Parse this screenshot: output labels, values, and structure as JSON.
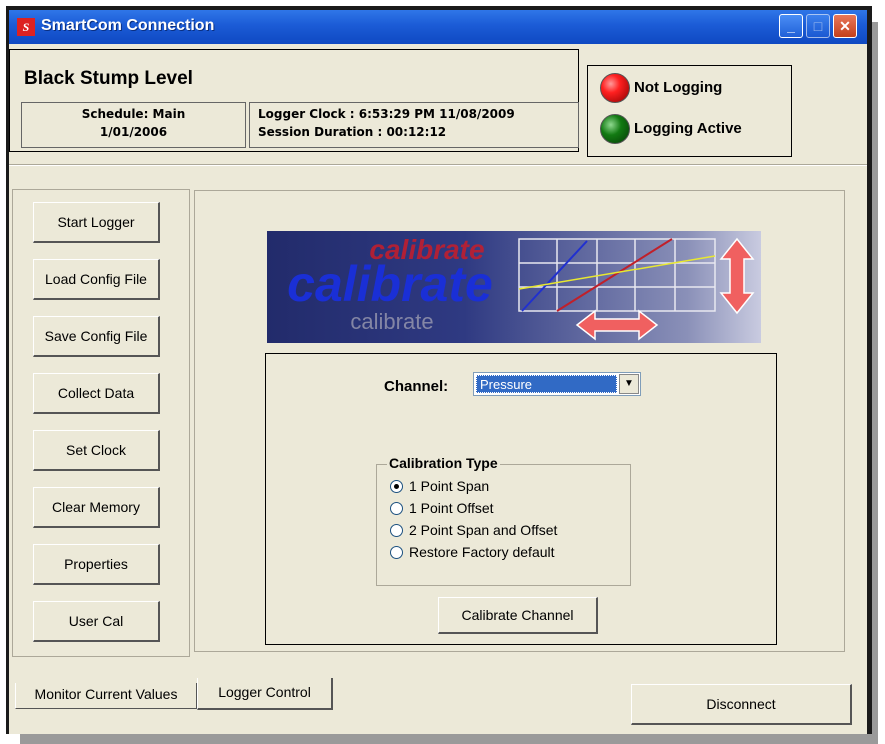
{
  "window": {
    "title": "SmartCom Connection",
    "icon_text": "S",
    "minimize_glyph": "_",
    "maximize_glyph": "□",
    "close_glyph": "✕"
  },
  "header": {
    "title": "Black Stump Level",
    "schedule_label": "Schedule: Main",
    "schedule_date": "1/01/2006",
    "logger_clock": "Logger Clock : 6:53:29 PM 11/08/2009",
    "session_duration": "Session Duration : 00:12:12"
  },
  "status": {
    "not_logging_label": "Not Logging",
    "logging_active_label": "Logging Active",
    "not_logging_color": "#ff2020",
    "logging_active_color": "#127a12"
  },
  "sidebar": {
    "buttons": [
      {
        "label": "Start Logger"
      },
      {
        "label": "Load Config File"
      },
      {
        "label": "Save Config File"
      },
      {
        "label": "Collect Data"
      },
      {
        "label": "Set Clock"
      },
      {
        "label": "Clear Memory"
      },
      {
        "label": "Properties"
      },
      {
        "label": "User Cal"
      }
    ]
  },
  "banner": {
    "word_top": "calibrate",
    "word_middle": "calibrate",
    "word_bottom": "calibrate"
  },
  "calibration": {
    "channel_label": "Channel:",
    "channel_value": "Pressure",
    "group_title": "Calibration Type",
    "options": [
      {
        "label": "1 Point Span",
        "selected": true
      },
      {
        "label": "1 Point Offset",
        "selected": false
      },
      {
        "label": "2 Point Span and Offset",
        "selected": false
      },
      {
        "label": "Restore Factory default",
        "selected": false
      }
    ],
    "calibrate_button": "Calibrate Channel"
  },
  "tabs": {
    "monitor": "Monitor Current Values",
    "logger": "Logger Control",
    "active": "Logger Control"
  },
  "footer": {
    "disconnect_label": "Disconnect"
  }
}
